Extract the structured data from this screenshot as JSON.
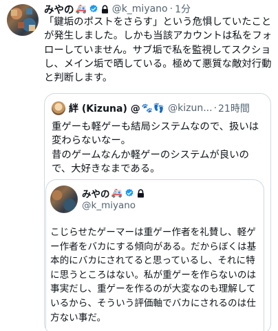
{
  "tweet": {
    "name": "みやの",
    "name_emoji": "🚑",
    "handle": "@k_miyano",
    "separator": "·",
    "time": "1分",
    "text": "「鍵垢のポストをさらす」という危惧していたことが発生しました。しかも当該アカウントは私をフォローしていません。サブ垢で私を監視してスクショし、メイン垢で晒している。極めて悪質な敵対行動と判断します。"
  },
  "quote": {
    "name": "絆 (Kizuna) @",
    "name_emoji": "🐾👣",
    "handle": "@kizun...",
    "separator": "·",
    "time": "21時間",
    "text": "重ゲーも軽ゲーも結局システムなので、扱いは変わらないなー。\n昔のゲームなんか軽ゲーのシステムが良いので、大好きなまである。"
  },
  "inner_quote": {
    "name": "みやの",
    "name_emoji": "🚑",
    "handle": "@k_miyano",
    "text": "こじらせたゲーマーは重ゲー作者を礼賛し、軽ゲー作者をバカにする傾向がある。だからぼくは基本的にバカにされてると思っているし、それに特に思うところはない。私が重ゲーを作らないのは事実だし、重ゲーを作るのが大変なのも理解しているから、そういう評価軸でバカにされるのは仕方ない事だ。"
  },
  "colors": {
    "verified": "#1d9bf0",
    "secondary_text": "#536471",
    "border": "#cfd9de"
  },
  "icons": {
    "verified": "verified-badge-icon",
    "lock": "lock-icon"
  }
}
